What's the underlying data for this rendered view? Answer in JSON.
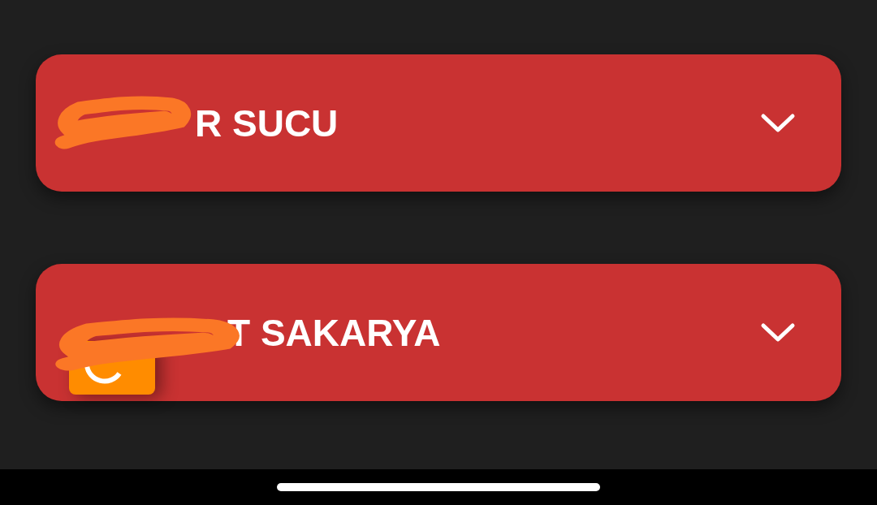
{
  "cards": [
    {
      "title": "R SUCU",
      "expanded": false
    },
    {
      "title": "T SAKARYA",
      "expanded": false
    }
  ]
}
